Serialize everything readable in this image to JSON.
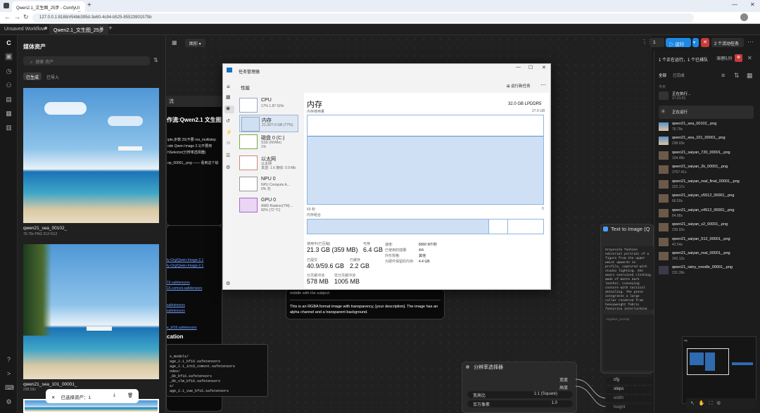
{
  "browser": {
    "tab_title": "Qwen2.1_文生图_25步 - ComfyUI",
    "url": "127.0.0.1:8188/#54bb395d-3e60-4c94-b525-85523901575b"
  },
  "workflow_tabs": [
    "Unsaved Workflow",
    "Qwen2.1_文生图_25步"
  ],
  "media": {
    "title": "媒体资产",
    "search_placeholder": "搜索 资产",
    "tabs": [
      "已生成",
      "已导入"
    ],
    "items": [
      {
        "name": "qwen21_sea_00102_",
        "meta": "76.79s  PNG  512×512"
      },
      {
        "name": "qwen21_sea_101_00001_",
        "meta": "238.03s"
      }
    ],
    "selection": "已选择资产：1"
  },
  "canvas": {
    "graph_btn": "图形",
    "panel_title": "流",
    "workflow_heading": "作流:Qwen2.1 文生图",
    "desc_lines": [
      "iple,步数 25(不要 res_multistep",
      "ode Qwen Image 2.1(不要用",
      "hSelector(分辨率选择器)"
    ],
    "desc_extra": "op_00001_.png —— 看到这个输",
    "links": [
      "ly-Org/Qwen-Image-2.1",
      "ly-Org/Qwen-Image-2.1",
      "16.safetensors",
      "16.comvot.safetensors",
      "safetensors",
      "safetensors",
      "e_bf16.safetensors"
    ],
    "location_heading": "cation",
    "code_lines": [
      "s_models/",
      "age_2.1_bf16.safetensors",
      "age_2.1_int8_comvot.safetensors",
      "odes/",
      "_8b_bf16.safetensors",
      "_8b_vlm_bf16.safetensors",
      "s/",
      "age_2.1_vae_bf16.safetensors"
    ],
    "prompt_tail": "middle with the subject:",
    "prompt_note": "This is an RGBA format image with transparency, [your description]. The image has an alpha channel and a transparent background.",
    "t2i_title": "Text to Image (Q",
    "t2i_text": "Grayscale fashion editorial portrait of a figure from the upper waist upwards in profile, captured with studio lighting. She wears oversized clothing made of matte dark leather, conveying couture with tactical detailing. The piece integrates a large collar rendered from heavyweight fabric featuring interlocking oversized panels, contour blotches in stark monochrome that mimic military disruptive patterns in a refined runway style. Around her shoulders, asymmetric pleated webbing and tailored cargo straps are integrated seamlessly into the garment's architecture. In her gloved hand, she clutches a structured matte-leather geometric handbag accented with subtle tactical buckles, utility stitching, and dark brushed-metal hardware. Her skin texture is rendered with hyper-detailed clarity, sculpted by intense, razor-sharp",
    "neg_prompt": "negative_prompt",
    "res_node": {
      "title": "分辨率选择器",
      "out1": "宽度",
      "out2": "高度",
      "w1_label": "宽高比",
      "w1_value": "1:1 (Square)",
      "w2_label": "百万像素",
      "w2_value": "1.0"
    },
    "right_widgets": [
      "cfg",
      "steps",
      "width",
      "height"
    ]
  },
  "task_manager": {
    "window_title": "任务管理器",
    "page": "性能",
    "run_new": "运行新任务",
    "side": [
      {
        "name": "CPU",
        "sub": "17% 1.87 GHz"
      },
      {
        "name": "内存",
        "sub": "21.3/27.6 GB (77%)"
      },
      {
        "name": "磁盘 0 (C:)",
        "sub": "SSD (NVMe)\n1%"
      },
      {
        "name": "以太网",
        "sub": "以太网\n发送: 1.6 接收: 0.9 Mb"
      },
      {
        "name": "NPU 0",
        "sub": "NPU Compute A...\n0% 无"
      },
      {
        "name": "GPU 0",
        "sub": "AMD Radeon(TM)...\n82% (72 °C)"
      }
    ],
    "heading": "内存",
    "spec": "32.0 GB LPDDR5",
    "usage_label": "内存使用量",
    "usage_max": "27.6 GB",
    "axis_left": "60 秒",
    "axis_right": "0",
    "comp_label": "内存组合",
    "stats": [
      {
        "l": "使用中(已压缩)",
        "v": "21.3 GB (359 MB)"
      },
      {
        "l": "可用",
        "v": "6.4 GB"
      },
      {
        "l": "已提交",
        "v": "40.9/59.6 GB"
      },
      {
        "l": "已缓存",
        "v": "2.2 GB"
      },
      {
        "l": "分页缓冲池",
        "v": "578 MB"
      },
      {
        "l": "非分页缓冲池",
        "v": "1005 MB"
      }
    ],
    "info": [
      [
        "速度:",
        "8000 MT/秒"
      ],
      [
        "已使用的插槽:",
        "4/4"
      ],
      [
        "外形规格:",
        "其他"
      ],
      [
        "为硬件保留的内存:",
        "4.4 GB"
      ]
    ]
  },
  "queue": {
    "run": "运行",
    "run_count": "1",
    "active": "2 个活动任务",
    "status": "1 个正在运行，1 个已排队",
    "clear": "清理队列",
    "tabs": [
      "全部",
      "已完成"
    ],
    "today": "今天",
    "running_label": "正在执行...",
    "running_time": "17:21:51",
    "in_progress": "正在运行",
    "items": [
      {
        "name": "qwen21_sea_00102_.png",
        "sub": "76.79s"
      },
      {
        "name": "qwen21_sea_101_00001_.png",
        "sub": "238.03s"
      },
      {
        "name": "qwen21_saiyan_720_00001_.png",
        "sub": "104.48s"
      },
      {
        "name": "qwen21_saiyan_2k_00001_.png",
        "sub": "2767.41s"
      },
      {
        "name": "qwen21_saiyan_real_final_00001_.png",
        "sub": "222.17s"
      },
      {
        "name": "qwen21_saiyan_v5512_00001_.png",
        "sub": "66.50s"
      },
      {
        "name": "qwen21_saiyan_v4512_00001_.png",
        "sub": "84.88s"
      },
      {
        "name": "qwen21_saiyan_v2_00001_.png",
        "sub": "239.93s"
      },
      {
        "name": "qwen21_saiyan_512_00001_.png",
        "sub": "42.54s"
      },
      {
        "name": "qwen21_saiyan_real_00001_.png",
        "sub": "242.12s"
      },
      {
        "name": "qwen21_rainy_noodle_00001_.png",
        "sub": "231.39s"
      }
    ]
  }
}
